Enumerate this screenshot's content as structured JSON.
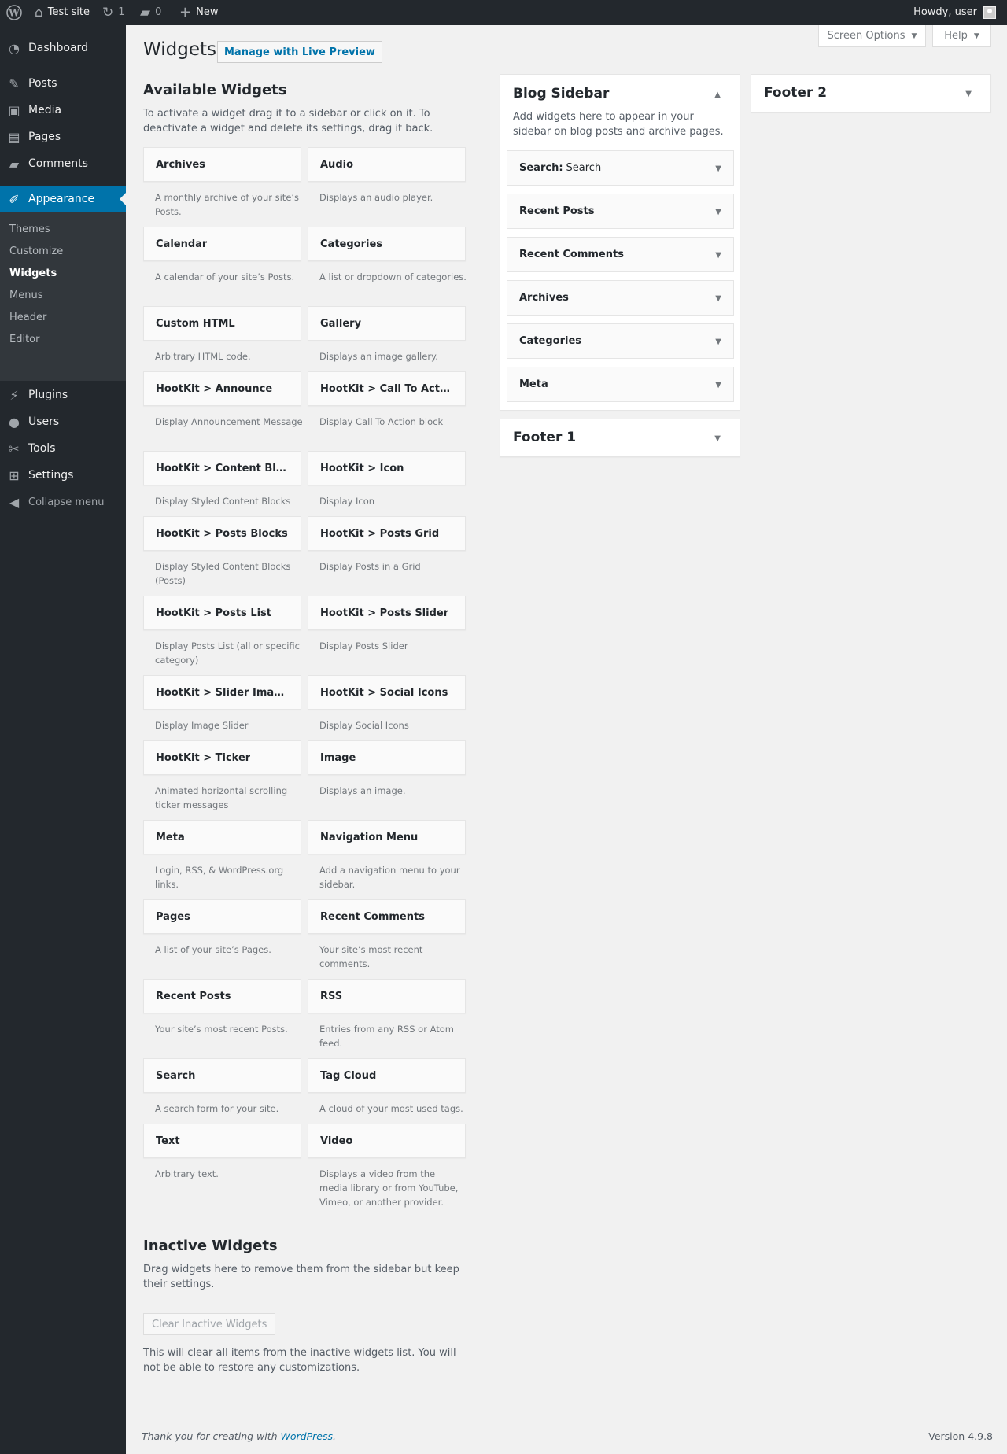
{
  "adminbar": {
    "site_name": "Test site",
    "updates_count": "1",
    "comments_count": "0",
    "new_label": "New",
    "howdy": "Howdy, user"
  },
  "menu": {
    "dashboard": "Dashboard",
    "posts": "Posts",
    "media": "Media",
    "pages": "Pages",
    "comments": "Comments",
    "appearance": "Appearance",
    "submenu": [
      "Themes",
      "Customize",
      "Widgets",
      "Menus",
      "Header",
      "Editor"
    ],
    "plugins": "Plugins",
    "users": "Users",
    "tools": "Tools",
    "settings": "Settings",
    "collapse": "Collapse menu"
  },
  "header": {
    "screen_options": "Screen Options",
    "help": "Help",
    "title": "Widgets",
    "live_preview": "Manage with Live Preview"
  },
  "available": {
    "title": "Available Widgets",
    "description": "To activate a widget drag it to a sidebar or click on it. To deactivate a widget and delete its settings, drag it back.",
    "widgets": [
      {
        "name": "Archives",
        "desc": "A monthly archive of your site’s Posts."
      },
      {
        "name": "Audio",
        "desc": "Displays an audio player."
      },
      {
        "name": "Calendar",
        "desc": "A calendar of your site’s Posts."
      },
      {
        "name": "Categories",
        "desc": "A list or dropdown of categories."
      },
      {
        "name": "Custom HTML",
        "desc": "Arbitrary HTML code."
      },
      {
        "name": "Gallery",
        "desc": "Displays an image gallery."
      },
      {
        "name": "HootKit > Announce",
        "desc": "Display Announcement Message"
      },
      {
        "name": "HootKit > Call To Action",
        "desc": "Display Call To Action block"
      },
      {
        "name": "HootKit > Content Bloc...",
        "desc": "Display Styled Content Blocks"
      },
      {
        "name": "HootKit > Icon",
        "desc": "Display Icon"
      },
      {
        "name": "HootKit > Posts Blocks",
        "desc": "Display Styled Content Blocks (Posts)"
      },
      {
        "name": "HootKit > Posts Grid",
        "desc": "Display Posts in a Grid"
      },
      {
        "name": "HootKit > Posts List",
        "desc": "Display Posts List (all or specific category)"
      },
      {
        "name": "HootKit > Posts Slider",
        "desc": "Display Posts Slider"
      },
      {
        "name": "HootKit > Slider Images",
        "desc": "Display Image Slider"
      },
      {
        "name": "HootKit > Social Icons",
        "desc": "Display Social Icons"
      },
      {
        "name": "HootKit > Ticker",
        "desc": "Animated horizontal scrolling ticker messages"
      },
      {
        "name": "Image",
        "desc": "Displays an image."
      },
      {
        "name": "Meta",
        "desc": "Login, RSS, & WordPress.org links."
      },
      {
        "name": "Navigation Menu",
        "desc": "Add a navigation menu to your sidebar."
      },
      {
        "name": "Pages",
        "desc": "A list of your site’s Pages."
      },
      {
        "name": "Recent Comments",
        "desc": "Your site’s most recent comments."
      },
      {
        "name": "Recent Posts",
        "desc": "Your site’s most recent Posts."
      },
      {
        "name": "RSS",
        "desc": "Entries from any RSS or Atom feed."
      },
      {
        "name": "Search",
        "desc": "A search form for your site."
      },
      {
        "name": "Tag Cloud",
        "desc": "A cloud of your most used tags."
      },
      {
        "name": "Text",
        "desc": "Arbitrary text."
      },
      {
        "name": "Video",
        "desc": "Displays a video from the media library or from YouTube, Vimeo, or another provider."
      }
    ]
  },
  "blog_sidebar": {
    "title": "Blog Sidebar",
    "description": "Add widgets here to appear in your sidebar on blog posts and archive pages.",
    "widgets": [
      {
        "name": "Search:",
        "instance_title": "Search"
      },
      {
        "name": "Recent Posts",
        "instance_title": ""
      },
      {
        "name": "Recent Comments",
        "instance_title": ""
      },
      {
        "name": "Archives",
        "instance_title": ""
      },
      {
        "name": "Categories",
        "instance_title": ""
      },
      {
        "name": "Meta",
        "instance_title": ""
      }
    ]
  },
  "footer1": {
    "title": "Footer 1"
  },
  "footer2": {
    "title": "Footer 2"
  },
  "inactive": {
    "title": "Inactive Widgets",
    "description": "Drag widgets here to remove them from the sidebar but keep their settings.",
    "clear_button": "Clear Inactive Widgets",
    "clear_note": "This will clear all items from the inactive widgets list. You will not be able to restore any customizations."
  },
  "footer": {
    "thanks_prefix": "Thank you for creating with",
    "wp_link": "WordPress",
    "thanks_suffix": ".",
    "version": "Version 4.9.8"
  }
}
